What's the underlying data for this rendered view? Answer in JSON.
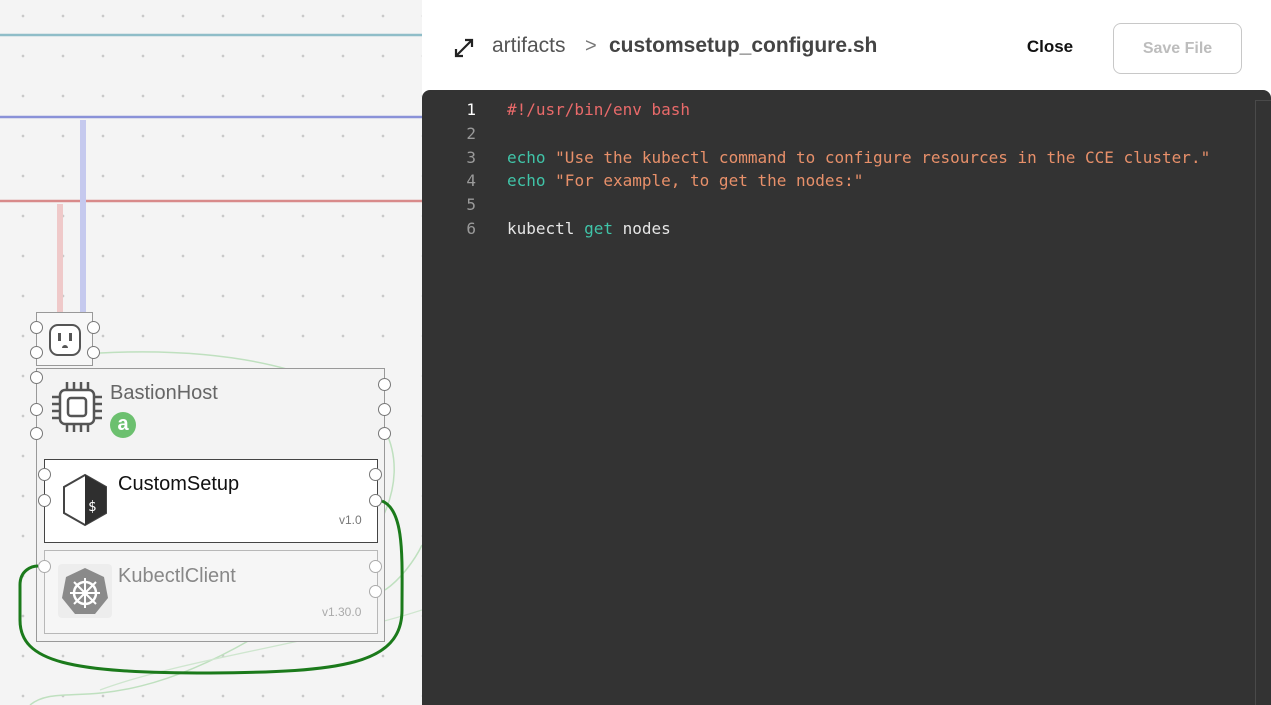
{
  "canvas": {
    "outlet_icon": "power-outlet-icon",
    "bastion": {
      "label": "BastionHost",
      "icon": "cpu-chip-icon",
      "badge": "a"
    },
    "custom_setup": {
      "label": "CustomSetup",
      "version": "v1.0",
      "icon": "bash-terminal-icon"
    },
    "kubectl_client": {
      "label": "KubectlClient",
      "version": "v1.30.0",
      "icon": "kubernetes-helm-icon"
    },
    "colors": {
      "wire_blue": "#8a92d8",
      "wire_red": "#d88a8a",
      "wire_teal": "#8fbdc8",
      "wire_green": "#1b7a1b",
      "badge_green": "#6cc06f"
    }
  },
  "panel": {
    "expand_icon": "expand-arrows-icon",
    "breadcrumb": {
      "root": "artifacts",
      "separator": ">",
      "file": "customsetup_configure.sh"
    },
    "close_label": "Close",
    "save_label": "Save File",
    "editor": {
      "background": "#333333",
      "lines": [
        {
          "no": "1",
          "tokens": [
            {
              "t": "#!/usr/bin/env bash",
              "c": "shebang"
            }
          ]
        },
        {
          "no": "2",
          "tokens": []
        },
        {
          "no": "3",
          "tokens": [
            {
              "t": "echo",
              "c": "kw"
            },
            {
              "t": " ",
              "c": "plain"
            },
            {
              "t": "\"Use the kubectl command to configure resources in the CCE cluster.\"",
              "c": "str"
            }
          ]
        },
        {
          "no": "4",
          "tokens": [
            {
              "t": "echo",
              "c": "kw"
            },
            {
              "t": " ",
              "c": "plain"
            },
            {
              "t": "\"For example, to get the nodes:\"",
              "c": "str"
            }
          ]
        },
        {
          "no": "5",
          "tokens": []
        },
        {
          "no": "6",
          "tokens": [
            {
              "t": "kubectl ",
              "c": "plain"
            },
            {
              "t": "get",
              "c": "kw"
            },
            {
              "t": " nodes",
              "c": "plain"
            }
          ]
        }
      ]
    }
  }
}
